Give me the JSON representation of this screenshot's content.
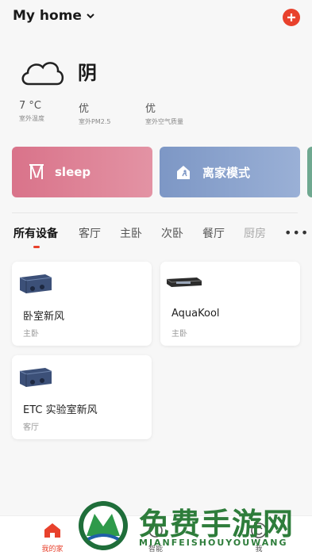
{
  "header": {
    "home_name": "My home"
  },
  "weather": {
    "condition": "阴",
    "stats": [
      {
        "value": "7 °C",
        "label": "室外温度"
      },
      {
        "value": "优",
        "label": "室外PM2.5"
      },
      {
        "value": "优",
        "label": "室外空气质量"
      }
    ]
  },
  "scenes": [
    {
      "label": "sleep",
      "color": "#d9738a"
    },
    {
      "label": "离家模式",
      "color": "#7d97c5"
    }
  ],
  "tabs": [
    "所有设备",
    "客厅",
    "主卧",
    "次卧",
    "餐厅",
    "厨房"
  ],
  "tabs_more": "•••",
  "devices": [
    {
      "name": "卧室新风",
      "room": "主卧"
    },
    {
      "name": "AquaKool",
      "room": "主卧"
    },
    {
      "name": "ETC 实验室新风",
      "room": "客厅"
    }
  ],
  "watermark": {
    "title": "免费手游网",
    "subtitle": "MIANFEISHOUYOUWANG"
  },
  "bottom_nav": [
    {
      "label": "我的家",
      "icon": "home-icon",
      "active": true
    },
    {
      "label": "智能",
      "icon": "smart-icon",
      "active": false
    },
    {
      "label": "我",
      "icon": "profile-icon",
      "active": false
    }
  ],
  "colors": {
    "accent": "#e8412c",
    "sleep": "#d9738a",
    "away": "#7d97c5"
  }
}
